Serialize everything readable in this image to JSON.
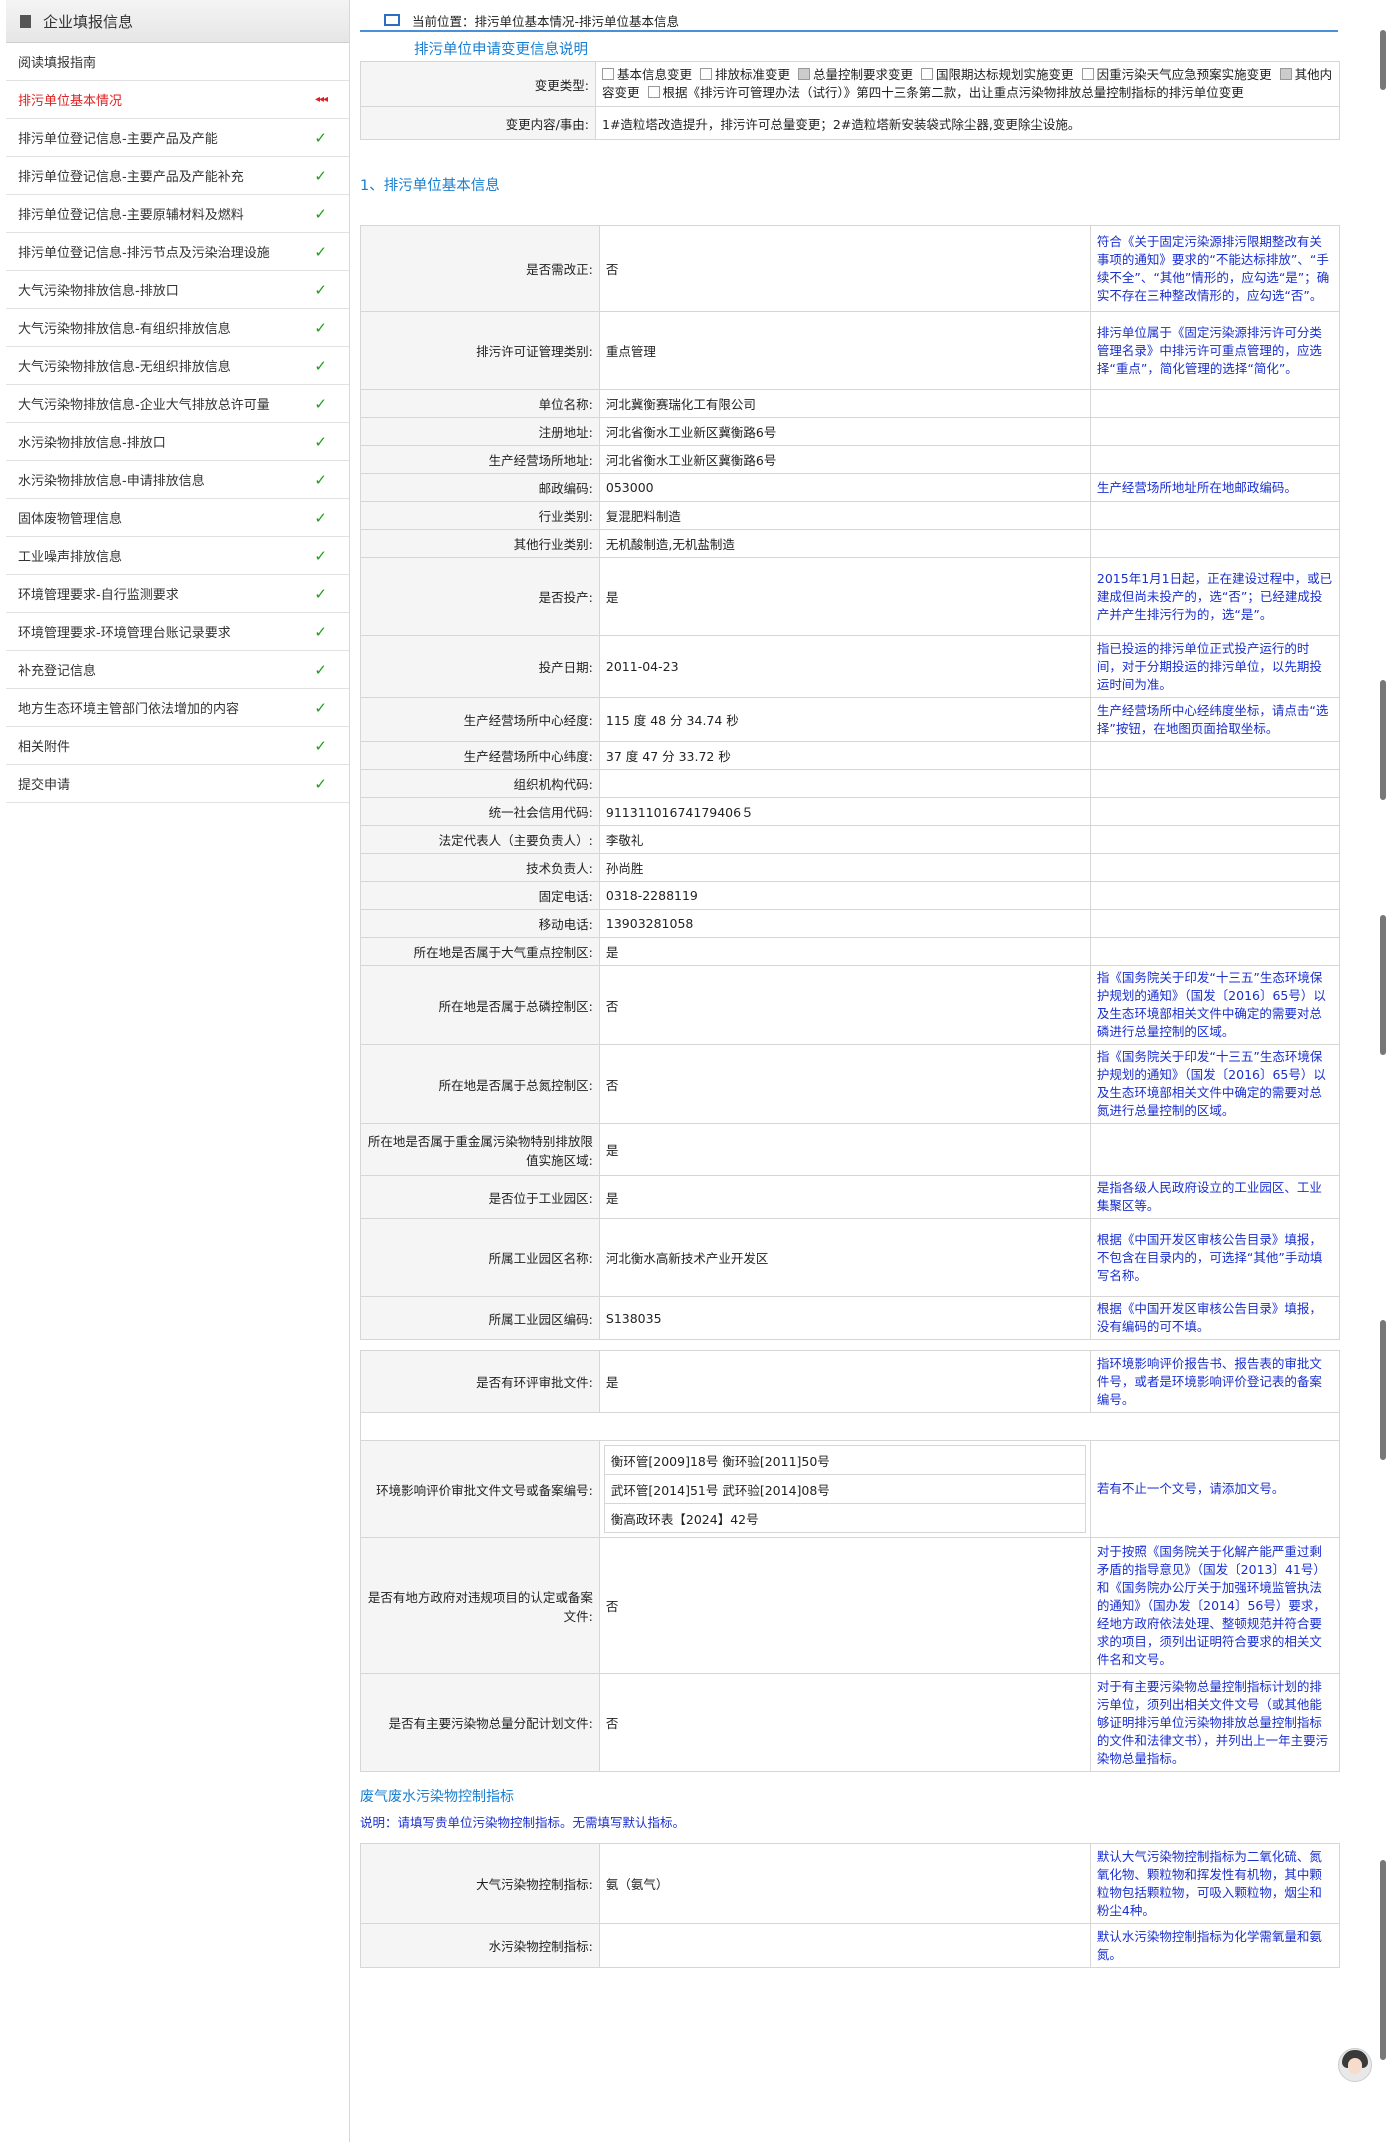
{
  "sidebar": {
    "title": "企业填报信息",
    "items": [
      {
        "label": "阅读填报指南",
        "status": ""
      },
      {
        "label": "排污单位基本情况",
        "status": "active"
      },
      {
        "label": "排污单位登记信息-主要产品及产能",
        "status": "done"
      },
      {
        "label": "排污单位登记信息-主要产品及产能补充",
        "status": "done"
      },
      {
        "label": "排污单位登记信息-主要原辅材料及燃料",
        "status": "done"
      },
      {
        "label": "排污单位登记信息-排污节点及污染治理设施",
        "status": "done"
      },
      {
        "label": "大气污染物排放信息-排放口",
        "status": "done"
      },
      {
        "label": "大气污染物排放信息-有组织排放信息",
        "status": "done"
      },
      {
        "label": "大气污染物排放信息-无组织排放信息",
        "status": "done"
      },
      {
        "label": "大气污染物排放信息-企业大气排放总许可量",
        "status": "done"
      },
      {
        "label": "水污染物排放信息-排放口",
        "status": "done"
      },
      {
        "label": "水污染物排放信息-申请排放信息",
        "status": "done"
      },
      {
        "label": "固体废物管理信息",
        "status": "done"
      },
      {
        "label": "工业噪声排放信息",
        "status": "done"
      },
      {
        "label": "环境管理要求-自行监测要求",
        "status": "done"
      },
      {
        "label": "环境管理要求-环境管理台账记录要求",
        "status": "done"
      },
      {
        "label": "补充登记信息",
        "status": "done"
      },
      {
        "label": "地方生态环境主管部门依法增加的内容",
        "status": "done"
      },
      {
        "label": "相关附件",
        "status": "done"
      },
      {
        "label": "提交申请",
        "status": "done"
      }
    ]
  },
  "breadcrumb": "当前位置：排污单位基本情况-排污单位基本信息",
  "change_section": {
    "title": "排污单位申请变更信息说明",
    "type_label": "变更类型:",
    "options": [
      {
        "label": "基本信息变更",
        "checked": false
      },
      {
        "label": "排放标准变更",
        "checked": false
      },
      {
        "label": "总量控制要求变更",
        "checked": true
      },
      {
        "label": "国限期达标规划实施变更",
        "checked": false
      },
      {
        "label": "因重污染天气应急预案实施变更",
        "checked": false
      },
      {
        "label": "其他内容变更",
        "checked": true
      },
      {
        "label": "根据《排污许可管理办法（试行）》第四十三条第二款，出让重点污染物排放总量控制指标的排污单位变更",
        "checked": false
      }
    ],
    "reason_label": "变更内容/事由:",
    "reason": "1#造粒塔改造提升，排污许可总量变更；2#造粒塔新安装袋式除尘器,变更除尘设施。"
  },
  "basic_title": "1、排污单位基本信息",
  "rows": [
    {
      "label": "是否需改正:",
      "value": "否",
      "note": "符合《关于固定污染源排污限期整改有关事项的通知》要求的“不能达标排放”、“手续不全”、“其他”情形的，应勾选“是”；确实不存在三种整改情形的，应勾选“否”。"
    },
    {
      "label": "排污许可证管理类别:",
      "value": "重点管理",
      "note": "排污单位属于《固定污染源排污许可分类管理名录》中排污许可重点管理的，应选择“重点”，简化管理的选择“简化”。"
    },
    {
      "label": "单位名称:",
      "value": "河北冀衡赛瑞化工有限公司",
      "note": ""
    },
    {
      "label": "注册地址:",
      "value": "河北省衡水工业新区冀衡路6号",
      "note": ""
    },
    {
      "label": "生产经营场所地址:",
      "value": "河北省衡水工业新区冀衡路6号",
      "note": ""
    },
    {
      "label": "邮政编码:",
      "value": "053000",
      "note": "生产经营场所地址所在地邮政编码。"
    },
    {
      "label": "行业类别:",
      "value": "复混肥料制造",
      "note": ""
    },
    {
      "label": "其他行业类别:",
      "value": "无机酸制造,无机盐制造",
      "note": ""
    },
    {
      "label": "是否投产:",
      "value": "是",
      "note": "2015年1月1日起，正在建设过程中，或已建成但尚未投产的，选“否”；已经建成投产并产生排污行为的，选“是”。"
    },
    {
      "label": "投产日期:",
      "value": "2011-04-23",
      "note": "指已投运的排污单位正式投产运行的时间，对于分期投运的排污单位，以先期投运时间为准。"
    },
    {
      "label": "生产经营场所中心经度:",
      "value": "115  度 48  分 34.74  秒",
      "note": "生产经营场所中心经纬度坐标，请点击“选择”按钮，在地图页面拾取坐标。"
    },
    {
      "label": "生产经营场所中心纬度:",
      "value": "37  度 47  分 33.72  秒",
      "note": ""
    },
    {
      "label": "组织机构代码:",
      "value": "",
      "note": ""
    },
    {
      "label": "统一社会信用代码:",
      "value": "91131101674179406５",
      "note": ""
    },
    {
      "label": "法定代表人（主要负责人）:",
      "value": "李敬礼",
      "note": ""
    },
    {
      "label": "技术负责人:",
      "value": "孙尚胜",
      "note": ""
    },
    {
      "label": "固定电话:",
      "value": "0318-2288119",
      "note": ""
    },
    {
      "label": "移动电话:",
      "value": "13903281058",
      "note": ""
    },
    {
      "label": "所在地是否属于大气重点控制区:",
      "value": "是",
      "note": ""
    },
    {
      "label": "所在地是否属于总磷控制区:",
      "value": "否",
      "note": "指《国务院关于印发“十三五”生态环境保护规划的通知》（国发〔2016〕65号）以及生态环境部相关文件中确定的需要对总磷进行总量控制的区域。"
    },
    {
      "label": "所在地是否属于总氮控制区:",
      "value": "否",
      "note": "指《国务院关于印发“十三五”生态环境保护规划的通知》（国发〔2016〕65号）以及生态环境部相关文件中确定的需要对总氮进行总量控制的区域。"
    },
    {
      "label": "所在地是否属于重金属污染物特别排放限值实施区域:",
      "value": "是",
      "note": ""
    },
    {
      "label": "是否位于工业园区:",
      "value": "是",
      "note": "是指各级人民政府设立的工业园区、工业集聚区等。"
    },
    {
      "label": "所属工业园区名称:",
      "value": "河北衡水高新技术产业开发区",
      "note": "根据《中国开发区审核公告目录》填报，不包含在目录内的，可选择“其他”手动填写名称。"
    },
    {
      "label": "所属工业园区编码:",
      "value": "S138035",
      "note": "根据《中国开发区审核公告目录》填报，没有编码的可不填。"
    }
  ],
  "eia": {
    "approval_label": "是否有环评审批文件:",
    "approval_value": "是",
    "approval_note": "指环境影响评价报告书、报告表的审批文件号，或者是环境影响评价登记表的备案编号。",
    "docs_label": "环境影响评价审批文件文号或备案编号:",
    "docs": [
      "衡环管[2009]18号 衡环验[2011]50号",
      "武环管[2014]51号 武环验[2014]08号",
      "衡高政环表【2024】42号"
    ],
    "docs_note": "若有不止一个文号，请添加文号。",
    "local_label": "是否有地方政府对违规项目的认定或备案文件:",
    "local_value": "否",
    "local_note": "对于按照《国务院关于化解产能严重过剩矛盾的指导意见》（国发〔2013〕41号）和《国务院办公厅关于加强环境监管执法的通知》（国办发〔2014〕56号）要求，经地方政府依法处理、整顿规范并符合要求的项目，须列出证明符合要求的相关文件名和文号。",
    "total_label": "是否有主要污染物总量分配计划文件:",
    "total_value": "否",
    "total_note": "对于有主要污染物总量控制指标计划的排污单位，须列出相关文件文号（或其他能够证明排污单位污染物排放总量控制指标的文件和法律文书），并列出上一年主要污染物总量指标。"
  },
  "control": {
    "title": "废气废水污染物控制指标",
    "note": "说明：请填写贵单位污染物控制指标。无需填写默认指标。",
    "air_label": "大气污染物控制指标:",
    "air_value": "氨（氨气）",
    "air_note": "默认大气污染物控制指标为二氧化硫、氮氧化物、颗粒物和挥发性有机物，其中颗粒物包括颗粒物，可吸入颗粒物，烟尘和粉尘4种。",
    "water_label": "水污染物控制指标:",
    "water_value": "",
    "water_note": "默认水污染物控制指标为化学需氧量和氨氮。"
  }
}
